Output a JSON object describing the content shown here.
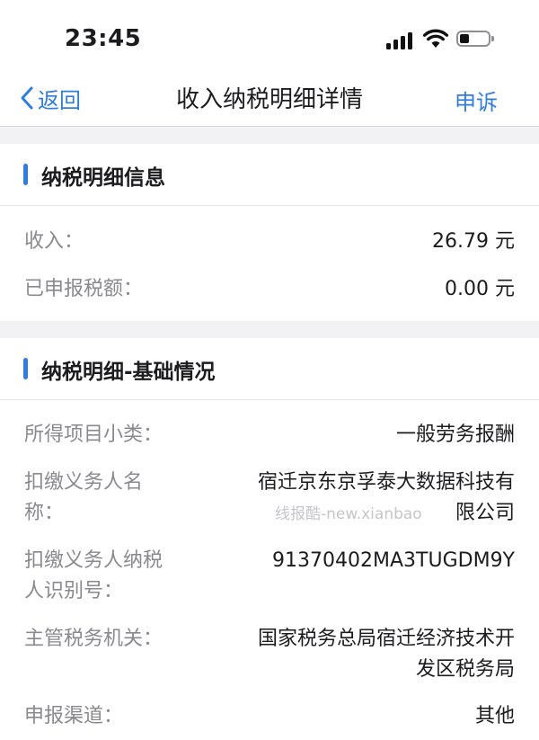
{
  "status_bar": {
    "time": "23:45"
  },
  "nav": {
    "back_label": "返回",
    "title": "收入纳税明细详情",
    "action_label": "申诉"
  },
  "section1": {
    "title": "纳税明细信息",
    "rows": [
      {
        "label": "收入：",
        "value": "26.79 元"
      },
      {
        "label": "已申报税额：",
        "value": "0.00 元"
      }
    ]
  },
  "section2": {
    "title": "纳税明细-基础情况",
    "rows": [
      {
        "label": "所得项目小类：",
        "value": "一般劳务报酬"
      },
      {
        "label_line1": "扣缴义务人名",
        "label_line2": "称：",
        "value_line1": "宿迁京东京孚泰大数据科技有",
        "value_line2": "限公司"
      },
      {
        "label_line1": "扣缴义务人纳税",
        "label_line2": "人识别号：",
        "value": "91370402MA3TUGDM9Y"
      },
      {
        "label": "主管税务机关：",
        "value_line1": "国家税务总局宿迁经济技术开",
        "value_line2": "发区税务局"
      },
      {
        "label": "申报渠道：",
        "value": "其他"
      }
    ]
  },
  "watermark": "线报酷-new.xianbao"
}
